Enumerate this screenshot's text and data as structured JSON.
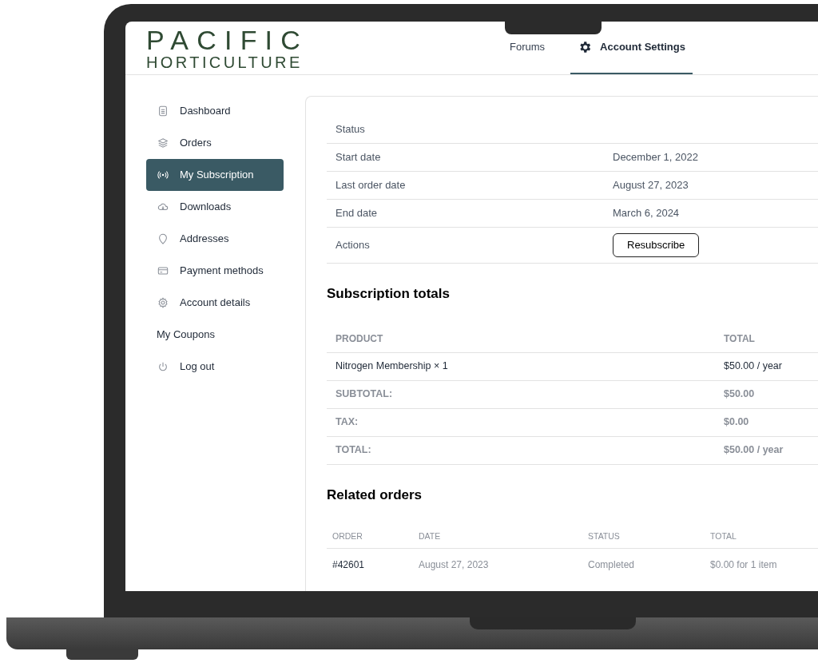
{
  "header": {
    "logo": {
      "line_1": "PACIFIC",
      "line_2": "HORTICULTURE"
    },
    "nav": [
      {
        "label": "Forums",
        "selected": false,
        "kind": "plain"
      },
      {
        "label": "Account Settings",
        "selected": true,
        "kind": "gear"
      }
    ]
  },
  "sidebar": {
    "items": [
      {
        "label": "Dashboard",
        "selected": false,
        "kind": "icon"
      },
      {
        "label": "Orders",
        "selected": false,
        "kind": "icon"
      },
      {
        "label": "My Subscription",
        "selected": true,
        "kind": "icon"
      },
      {
        "label": "Downloads",
        "selected": false,
        "kind": "icon"
      },
      {
        "label": "Addresses",
        "selected": false,
        "kind": "icon"
      },
      {
        "label": "Payment methods",
        "selected": false,
        "kind": "icon"
      },
      {
        "label": "Account details",
        "selected": false,
        "kind": "icon"
      },
      {
        "label": "My Coupons",
        "selected": false,
        "kind": "plain"
      },
      {
        "label": "Log out",
        "selected": false,
        "kind": "icon"
      }
    ]
  },
  "details": [
    {
      "label": "Status",
      "kind": "text"
    },
    {
      "label": "Start date",
      "value": "December 1, 2022",
      "kind": "text"
    },
    {
      "label": "Last order date",
      "value": "August 27, 2023",
      "kind": "text"
    },
    {
      "label": "End date",
      "value": "March 6, 2024",
      "kind": "text"
    },
    {
      "label": "Actions",
      "value": "Resubscribe",
      "kind": "button"
    }
  ],
  "subscription_totals": {
    "heading": "Subscription totals",
    "columns": [
      "PRODUCT",
      "TOTAL"
    ],
    "rows": [
      {
        "label": "Nitrogen Membership × 1",
        "value": "$50.00 / year",
        "kind": "item"
      },
      {
        "label": "SUBTOTAL:",
        "value": "$50.00",
        "kind": "summary"
      },
      {
        "label": "TAX:",
        "value": "$0.00",
        "kind": "summary"
      },
      {
        "label": "TOTAL:",
        "value": "$50.00 / year",
        "kind": "summary"
      }
    ]
  },
  "related_orders": {
    "heading": "Related orders",
    "columns": [
      "ORDER",
      "DATE",
      "STATUS",
      "TOTAL"
    ],
    "rows": [
      {
        "order": "#42601",
        "date": "August 27, 2023",
        "status": "Completed",
        "total": "$0.00 for 1 item"
      }
    ]
  }
}
